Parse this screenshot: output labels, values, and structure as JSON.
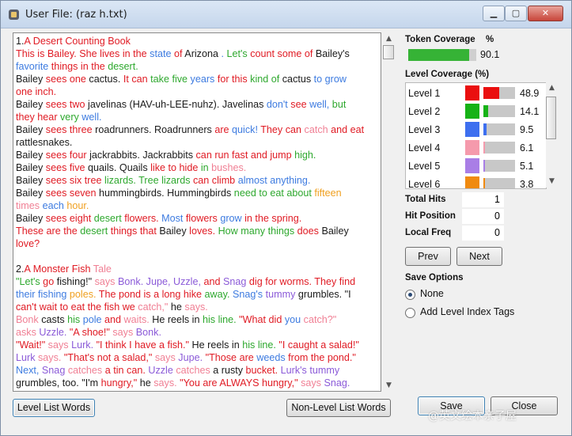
{
  "window": {
    "title": "User File: (raz h.txt)"
  },
  "titlebar": {
    "minimize_glyph": "▁",
    "maximize_glyph": "▢",
    "close_glyph": "✕"
  },
  "colors": {
    "black": "#1a1a1a",
    "red": "#e01b24",
    "green": "#2ea82e",
    "blue": "#3d7be0",
    "pink": "#f07f94",
    "purple": "#8b5ad8",
    "orange": "#f0a020",
    "gray": "#b0b0b0"
  },
  "text_lines": [
    [
      [
        "1.",
        "black"
      ],
      [
        "A",
        "red"
      ],
      [
        " Desert Counting Book",
        "red"
      ]
    ],
    [
      [
        "This is Bailey. She lives in the",
        "red"
      ],
      [
        " state",
        "blue"
      ],
      [
        " of",
        "red"
      ],
      [
        " Arizona",
        "black"
      ],
      [
        " . ",
        "blue"
      ],
      [
        "Let's",
        "green"
      ],
      [
        " count some of",
        "red"
      ],
      [
        " Bailey's",
        "black"
      ]
    ],
    [
      [
        "favorite",
        "blue"
      ],
      [
        " things in the",
        "red"
      ],
      [
        " desert.",
        "green"
      ]
    ],
    [
      [
        "Bailey",
        "black"
      ],
      [
        " sees one",
        "red"
      ],
      [
        " cactus.",
        "black"
      ],
      [
        " It can",
        "red"
      ],
      [
        " take five",
        "green"
      ],
      [
        " years",
        "blue"
      ],
      [
        " for this",
        "red"
      ],
      [
        " kind of",
        "green"
      ],
      [
        " cactus",
        "black"
      ],
      [
        " to grow",
        "blue"
      ]
    ],
    [
      [
        "one inch.",
        "red"
      ]
    ],
    [
      [
        "Bailey",
        "black"
      ],
      [
        " sees two",
        "red"
      ],
      [
        " javelinas (HAV-uh-LEE-nuhz). Javelinas",
        "black"
      ],
      [
        " don't",
        "blue"
      ],
      [
        " see",
        "red"
      ],
      [
        " well,",
        "blue"
      ],
      [
        " but",
        "green"
      ]
    ],
    [
      [
        "they hear",
        "red"
      ],
      [
        " very",
        "green"
      ],
      [
        " well.",
        "blue"
      ]
    ],
    [
      [
        "Bailey",
        "black"
      ],
      [
        " sees three",
        "red"
      ],
      [
        " roadrunners. Roadrunners",
        "black"
      ],
      [
        " are",
        "red"
      ],
      [
        " quick!",
        "blue"
      ],
      [
        " They can",
        "red"
      ],
      [
        " catch",
        "pink"
      ],
      [
        " and eat",
        "red"
      ]
    ],
    [
      [
        "rattlesnakes.",
        "black"
      ]
    ],
    [
      [
        "Bailey",
        "black"
      ],
      [
        " sees four",
        "red"
      ],
      [
        " jackrabbits. Jackrabbits",
        "black"
      ],
      [
        " can run fast and jump",
        "red"
      ],
      [
        " high.",
        "green"
      ]
    ],
    [
      [
        "Bailey",
        "black"
      ],
      [
        " sees five",
        "red"
      ],
      [
        " quails. Quails",
        "black"
      ],
      [
        " like to hide",
        "red"
      ],
      [
        " in",
        "green"
      ],
      [
        " bushes.",
        "pink"
      ]
    ],
    [
      [
        "Bailey",
        "black"
      ],
      [
        " sees six tree",
        "red"
      ],
      [
        " lizards. Tree lizards",
        "green"
      ],
      [
        " can climb",
        "red"
      ],
      [
        " almost anything.",
        "blue"
      ]
    ],
    [
      [
        "Bailey",
        "black"
      ],
      [
        " sees seven",
        "red"
      ],
      [
        " hummingbirds. Hummingbirds",
        "black"
      ],
      [
        " need to eat about",
        "green"
      ],
      [
        " fifteen",
        "orange"
      ]
    ],
    [
      [
        "times",
        "pink"
      ],
      [
        " each",
        "blue"
      ],
      [
        " hour.",
        "orange"
      ]
    ],
    [
      [
        "Bailey",
        "black"
      ],
      [
        " sees eight",
        "red"
      ],
      [
        " desert",
        "green"
      ],
      [
        " flowers.",
        "red"
      ],
      [
        " Most",
        "blue"
      ],
      [
        " flowers",
        "red"
      ],
      [
        " grow",
        "blue"
      ],
      [
        " in the spring.",
        "red"
      ]
    ],
    [
      [
        "These are the",
        "red"
      ],
      [
        " desert",
        "green"
      ],
      [
        " things that",
        "red"
      ],
      [
        " Bailey",
        "black"
      ],
      [
        " loves.",
        "red"
      ],
      [
        " How many things",
        "green"
      ],
      [
        " does",
        "red"
      ],
      [
        " Bailey",
        "black"
      ]
    ],
    [
      [
        "love?",
        "red"
      ]
    ],
    [
      [
        "",
        "black"
      ]
    ],
    [
      [
        "2.",
        "black"
      ],
      [
        "A",
        "red"
      ],
      [
        " Monster Fish",
        "red"
      ],
      [
        " Tale",
        "pink"
      ]
    ],
    [
      [
        "\"Let's",
        "green"
      ],
      [
        " go",
        "red"
      ],
      [
        " fishing!\"",
        "black"
      ],
      [
        " says",
        "pink"
      ],
      [
        " Bonk. Jupe, Uzzle,",
        "purple"
      ],
      [
        " and",
        "red"
      ],
      [
        " Snag",
        "purple"
      ],
      [
        " dig for worms. They find",
        "red"
      ]
    ],
    [
      [
        "their fishing",
        "blue"
      ],
      [
        " poles.",
        "orange"
      ],
      [
        " The pond is a long hike",
        "red"
      ],
      [
        " away.",
        "green"
      ],
      [
        " Snag's",
        "blue"
      ],
      [
        " tummy",
        "purple"
      ],
      [
        " grumbles. \"I",
        "black"
      ]
    ],
    [
      [
        "can't wait to eat the fish we",
        "red"
      ],
      [
        " catch,\"",
        "pink"
      ],
      [
        " he",
        "black"
      ],
      [
        " says.",
        "pink"
      ]
    ],
    [
      [
        "Bonk",
        "pink"
      ],
      [
        " casts",
        "black"
      ],
      [
        " his",
        "green"
      ],
      [
        " pole",
        "blue"
      ],
      [
        " and",
        "red"
      ],
      [
        " waits.",
        "pink"
      ],
      [
        " He reels in",
        "black"
      ],
      [
        " his line.",
        "green"
      ],
      [
        " \"What did",
        "red"
      ],
      [
        " you",
        "blue"
      ],
      [
        " catch?\"",
        "pink"
      ]
    ],
    [
      [
        "asks",
        "pink"
      ],
      [
        " Uzzle.",
        "purple"
      ],
      [
        " \"A shoe!\"",
        "red"
      ],
      [
        " says",
        "pink"
      ],
      [
        " Bonk.",
        "purple"
      ]
    ],
    [
      [
        "\"Wait!\"",
        "red"
      ],
      [
        " says",
        "pink"
      ],
      [
        " Lurk.",
        "purple"
      ],
      [
        " \"I think I have a fish.\"",
        "red"
      ],
      [
        " He reels in",
        "black"
      ],
      [
        " his line.",
        "green"
      ],
      [
        " \"I caught a salad!\"",
        "red"
      ]
    ],
    [
      [
        "Lurk",
        "purple"
      ],
      [
        " says.",
        "pink"
      ],
      [
        " \"That's not a salad,\"",
        "red"
      ],
      [
        " says",
        "pink"
      ],
      [
        " Jupe.",
        "purple"
      ],
      [
        " \"Those are",
        "red"
      ],
      [
        " weeds",
        "blue"
      ],
      [
        " from the pond.\"",
        "red"
      ]
    ],
    [
      [
        "Next,",
        "blue"
      ],
      [
        " Snag",
        "purple"
      ],
      [
        " catches",
        "pink"
      ],
      [
        " a tin can.",
        "red"
      ],
      [
        " Uzzle",
        "purple"
      ],
      [
        " catches",
        "pink"
      ],
      [
        " a rusty",
        "black"
      ],
      [
        " bucket.",
        "red"
      ],
      [
        " Lurk's",
        "purple"
      ],
      [
        " tummy",
        "purple"
      ]
    ],
    [
      [
        "grumbles, too. \"I'm",
        "black"
      ],
      [
        " hungry,\"",
        "red"
      ],
      [
        " he",
        "black"
      ],
      [
        " says.",
        "pink"
      ],
      [
        " \"You are ALWAYS",
        "red"
      ],
      [
        " hungry,\"",
        "red"
      ],
      [
        " says",
        "pink"
      ],
      [
        " Snag.",
        "purple"
      ]
    ]
  ],
  "buttons": {
    "level_list_words": "Level List Words",
    "non_level_list_words": "Non-Level List Words",
    "prev": "Prev",
    "next": "Next",
    "save": "Save",
    "close": "Close"
  },
  "token_coverage": {
    "label": "Token Coverage",
    "unit": "%",
    "value": "90.1",
    "fraction": 0.901,
    "bar_color": "#36b336"
  },
  "level_coverage": {
    "label": "Level Coverage (%)",
    "levels": [
      {
        "name": "Level 1",
        "color": "#ea0f0f",
        "value": "48.9",
        "fraction": 0.489
      },
      {
        "name": "Level 2",
        "color": "#16b216",
        "value": "14.1",
        "fraction": 0.141
      },
      {
        "name": "Level 3",
        "color": "#3d6fef",
        "value": "9.5",
        "fraction": 0.095
      },
      {
        "name": "Level 4",
        "color": "#f59aac",
        "value": "6.1",
        "fraction": 0.061
      },
      {
        "name": "Level 5",
        "color": "#a97ee6",
        "value": "5.1",
        "fraction": 0.051
      },
      {
        "name": "Level 6",
        "color": "#f08a10",
        "value": "3.8",
        "fraction": 0.038
      }
    ]
  },
  "stats": {
    "total_hits_label": "Total Hits",
    "total_hits": "1",
    "hit_position_label": "Hit Position",
    "hit_position": "0",
    "local_freq_label": "Local Freq",
    "local_freq": "0"
  },
  "save_options": {
    "label": "Save Options",
    "none": "None",
    "add_tags": "Add Level Index Tags",
    "selected": "None"
  },
  "watermark": "@英文绘本亲子屋"
}
